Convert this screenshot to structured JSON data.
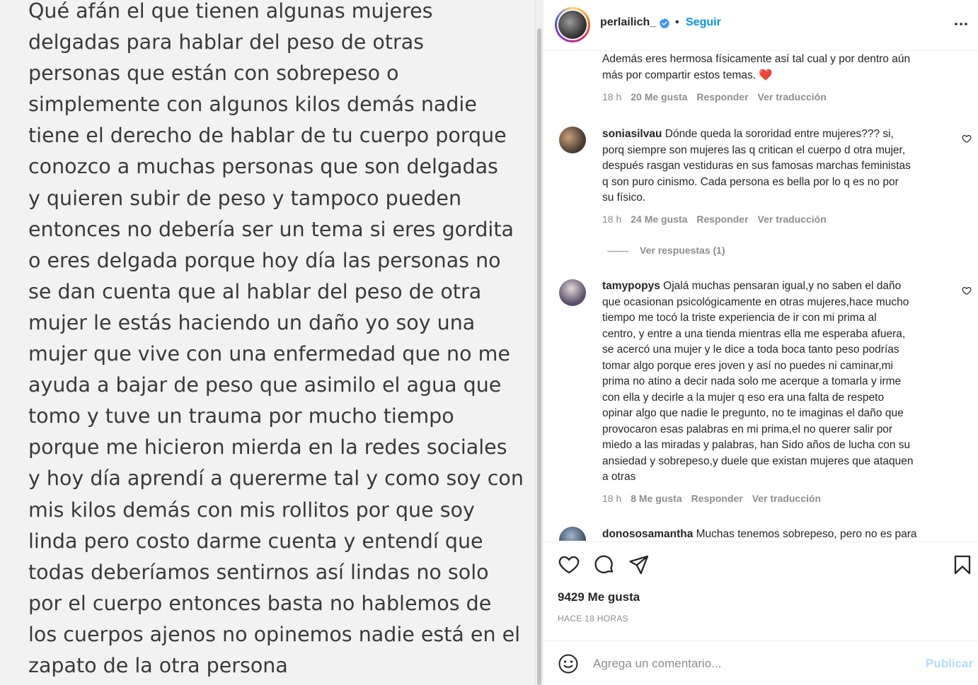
{
  "post_text": [
    "Qué afán el que tienen algunas mujeres",
    "delgadas para hablar del peso de otras",
    "personas que están con sobrepeso o",
    "simplemente con algunos kilos demás nadie",
    "tiene el derecho de hablar de tu cuerpo porque",
    "conozco a muchas personas que son delgadas",
    "y quieren subir de peso y tampoco pueden",
    "entonces no debería ser un tema si eres gordita",
    "o eres delgada porque hoy día las personas no",
    "se dan cuenta que al hablar del peso de otra",
    "mujer le estás haciendo un daño yo soy una",
    "mujer que vive con una enfermedad que no me",
    "ayuda a bajar de peso que asimilo el agua que",
    "tomo y tuve un trauma por mucho tiempo",
    "porque me hicieron mierda en la redes sociales",
    "y hoy día aprendí a quererme tal y como soy con",
    "mis kilos demás con mis rollitos por que soy",
    "linda  pero costo darme cuenta y entendí que",
    "todas deberíamos sentirnos así  lindas no solo",
    "por el cuerpo entonces basta no hablemos de",
    "los cuerpos ajenos no opinemos nadie está en el",
    "zapato de la otra persona"
  ],
  "header": {
    "username": "perlailich_",
    "separator": "•",
    "follow_label": "Seguir"
  },
  "comments": [
    {
      "username": "",
      "text_lines": [
        "Además eres hermosa físicamente así tal cual y por dentro aún",
        "más por compartir estos temas. ❤️"
      ],
      "time": "18 h",
      "likes": "20 Me gusta",
      "reply": "Responder",
      "translate": "Ver traducción"
    },
    {
      "username": "soniasilvau",
      "text_lines": [
        "Dónde queda la sororidad entre mujeres??? si,",
        "porq siempre son mujeres las q critican el cuerpo d otra mujer,",
        "después rasgan vestiduras en sus famosas marchas feministas",
        "q son puro cinismo. Cada persona es bella por lo q es no por",
        "su físico."
      ],
      "time": "18 h",
      "likes": "24 Me gusta",
      "reply": "Responder",
      "translate": "Ver traducción",
      "view_replies": "Ver respuestas (1)"
    },
    {
      "username": "tamypopys",
      "text_lines": [
        "Ojalá muchas pensaran igual,y no saben el daño",
        "que ocasionan psicológicamente en otras mujeres,hace mucho",
        "tiempo me tocó la triste experiencia de ir con mi prima al",
        "centro, y entre a una tienda mientras ella me esperaba afuera,",
        "se acercó una mujer y le dice a toda boca tanto peso podrías",
        "tomar algo porque eres joven y así no puedes ni caminar,mi",
        "prima no atino a decir nada solo me acerque a tomarla y irme",
        "con ella y decirle a la mujer q eso era una falta de respeto",
        "opinar algo que nadie le pregunto, no te imaginas el daño que",
        "provocaron esas palabras en mi prima,el no querer salir por",
        "miedo a las miradas y palabras, han Sido años de lucha con su",
        "ansiedad y sobrepeso,y duele que existan mujeres que ataquen",
        "a otras"
      ],
      "time": "18 h",
      "likes": "8 Me gusta",
      "reply": "Responder",
      "translate": "Ver traducción"
    },
    {
      "username": "donososamantha",
      "text_lines": [
        "Muchas tenemos sobrepeso, pero no es para"
      ]
    }
  ],
  "actions": {
    "likes_count": "9429 Me gusta",
    "time_ago": "HACE 18 HORAS"
  },
  "comment_bar": {
    "placeholder": "Agrega un comentario...",
    "publish_label": "Publicar"
  },
  "icons": {
    "like": "heart-icon",
    "comment": "comment-icon",
    "share": "paper-plane-icon",
    "save": "bookmark-icon",
    "emoji": "smiley-icon",
    "more": "more-options-icon",
    "verified": "verified-badge-icon"
  },
  "colors": {
    "accent": "#0095f6",
    "muted": "#8e8e8e",
    "publish_disabled": "#b2dffc",
    "verified": "#3897f0"
  }
}
